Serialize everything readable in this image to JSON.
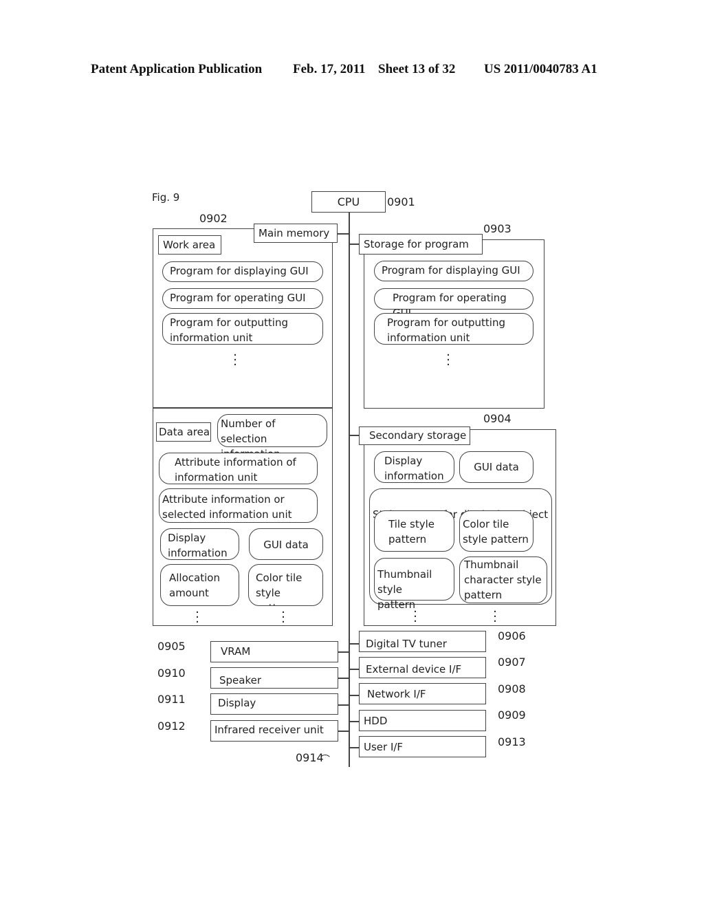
{
  "header": {
    "publication": "Patent Application Publication",
    "date": "Feb. 17, 2011",
    "sheet": "Sheet 13 of 32",
    "number": "US 2011/0040783 A1"
  },
  "figure": {
    "label": "Fig. 9",
    "cpu": {
      "label": "CPU",
      "ref": "0901"
    },
    "bus_ref": "0914",
    "main_memory": {
      "label": "Main memory",
      "ref": "0902",
      "work_area": {
        "label": "Work area",
        "items": [
          "Program for displaying GUI",
          "Program for operating GUI",
          "Program for outputting\ninformation unit"
        ]
      },
      "data_area": {
        "label": "Data area",
        "items": [
          "Number of selection\ninformation",
          "Attribute information of\ninformation unit",
          "Attribute information or\nselected information unit",
          "Display\ninformation",
          "GUI data",
          "Allocation\namount",
          "Color tile\nstyle pattern"
        ]
      }
    },
    "storage_for_program": {
      "label": "Storage for program",
      "ref": "0903",
      "items": [
        "Program for displaying GUI",
        "Program for operating GUI",
        "Program for outputting\ninformation unit"
      ]
    },
    "secondary_storage": {
      "label": "Secondary storage",
      "ref": "0904",
      "items": [
        "Display\ninformation",
        "GUI data"
      ],
      "style_group": {
        "label": "Style pattern for displaying object",
        "items": [
          "Tile style\npattern",
          "Color tile\nstyle pattern",
          "Thumbnail style\npattern",
          "Thumbnail\ncharacter style\npattern"
        ]
      }
    },
    "left_devices": [
      {
        "label": "VRAM",
        "ref": "0905"
      },
      {
        "label": "Speaker",
        "ref": "0910"
      },
      {
        "label": "Display",
        "ref": "0911"
      },
      {
        "label": "Infrared receiver unit",
        "ref": "0912"
      }
    ],
    "right_devices": [
      {
        "label": "Digital TV tuner",
        "ref": "0906"
      },
      {
        "label": "External device I/F",
        "ref": "0907"
      },
      {
        "label": "Network I/F",
        "ref": "0908"
      },
      {
        "label": "HDD",
        "ref": "0909"
      },
      {
        "label": "User I/F",
        "ref": "0913"
      }
    ]
  }
}
